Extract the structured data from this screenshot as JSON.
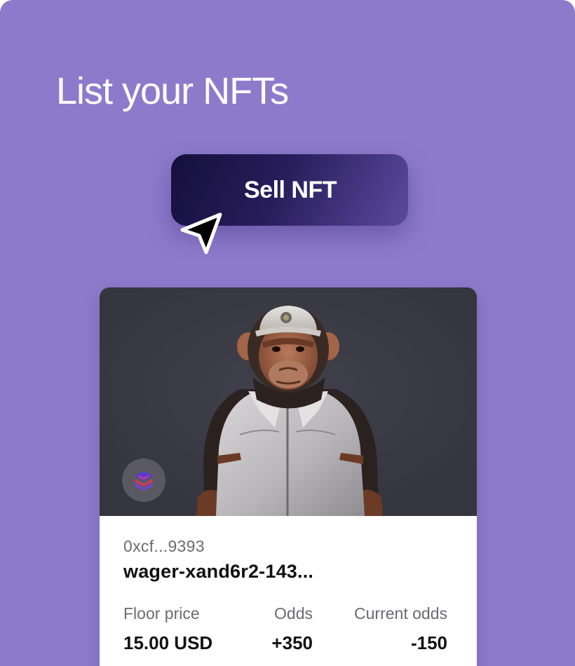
{
  "page": {
    "title": "List your NFTs"
  },
  "sell_button": {
    "label": "Sell NFT"
  },
  "nft_card": {
    "image_icon": "chimpanzee-in-cap-and-jacket-image",
    "collection_icon": "stacked-layers-icon",
    "owner_address": "0xcf...9393",
    "name": "wager-xand6r2-143...",
    "stats": [
      {
        "label": "Floor price",
        "value": "15.00 USD"
      },
      {
        "label": "Odds",
        "value": "+350"
      },
      {
        "label": "Current odds",
        "value": "-150"
      }
    ]
  },
  "colors": {
    "background": "#8e7acb",
    "button_dark": "#150f3c",
    "button_light": "#5a4a9e",
    "card_media_bg": "#393944",
    "card_bg": "#ffffff"
  }
}
